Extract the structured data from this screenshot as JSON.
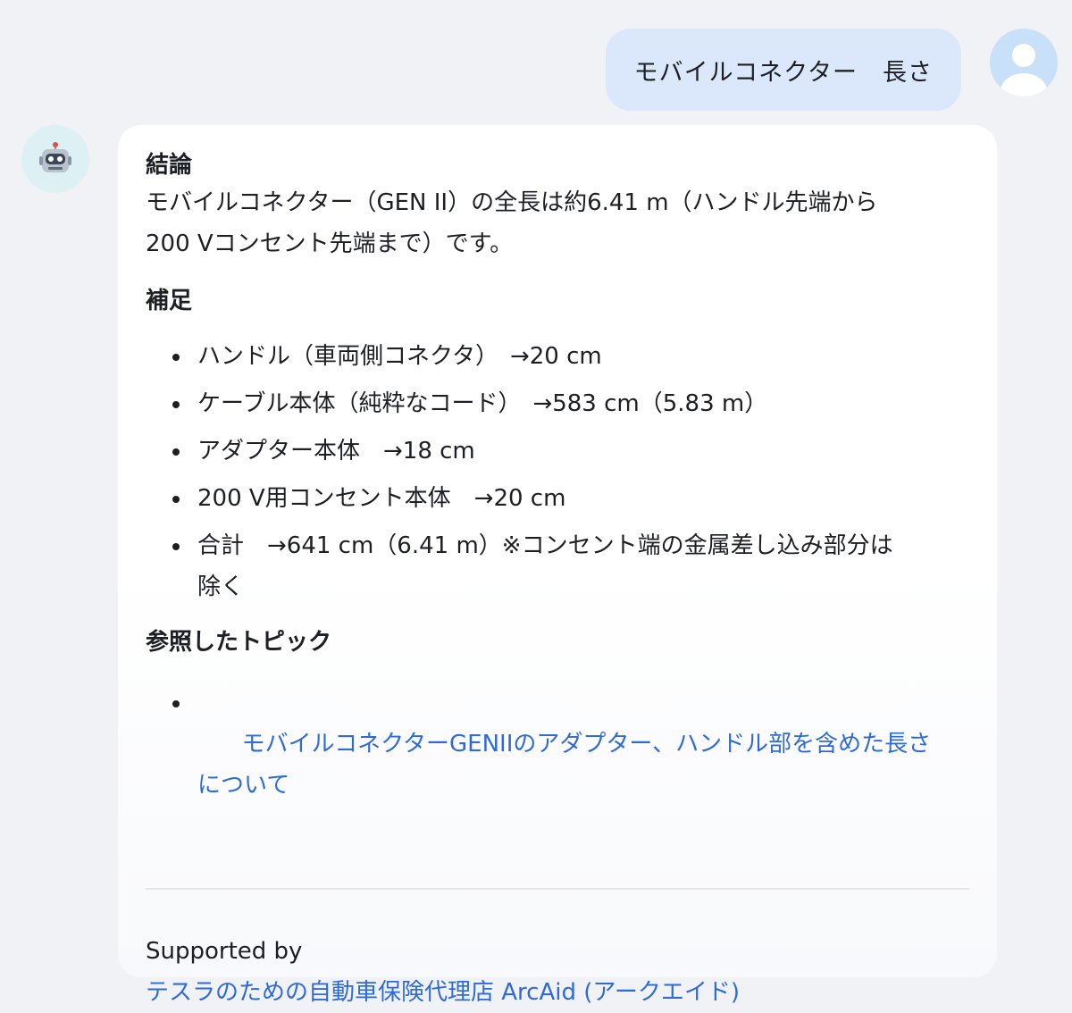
{
  "user_message": {
    "text": "モバイルコネクター　長さ",
    "avatar_icon": "user-silhouette-icon"
  },
  "bot": {
    "avatar_icon": "robot-face-icon",
    "sections": {
      "conclusion_heading": "結論",
      "conclusion_text_line1": "モバイルコネクター（GEN II）の全長は約6.41 m（ハンドル先端から",
      "conclusion_text_line2": "200 Vコンセント先端まで）です。",
      "supplement_heading": "補足",
      "supplement_items": [
        "ハンドル（車両側コネクタ）　→20 cm",
        "ケーブル本体（純粋なコード）　→583 cm（5.83 m）",
        "アダプター本体　→18 cm",
        "200 V用コンセント本体　→20 cm",
        "合計　→641 cm（6.41 m）※コンセント端の金属差し込み部分は"
      ],
      "supplement_item5_line2": "除く",
      "topics_heading": "参照したトピック",
      "topics_link_line1": "モバイルコネクターGENIIのアダプター、ハンドル部を含めた長さ",
      "topics_link_line2": "について"
    },
    "footer": {
      "supported_by": "Supported by",
      "provider_link": "テスラのための自動車保険代理店 ArcAid (アークエイド)"
    }
  },
  "colors": {
    "page_bg": "#f1f2f5",
    "user_bubble_bg": "#dbe8fb",
    "link": "#2f6bd6",
    "user_avatar_bg": "#c9e0f9",
    "bot_avatar_bg": "#ddf1f5"
  }
}
